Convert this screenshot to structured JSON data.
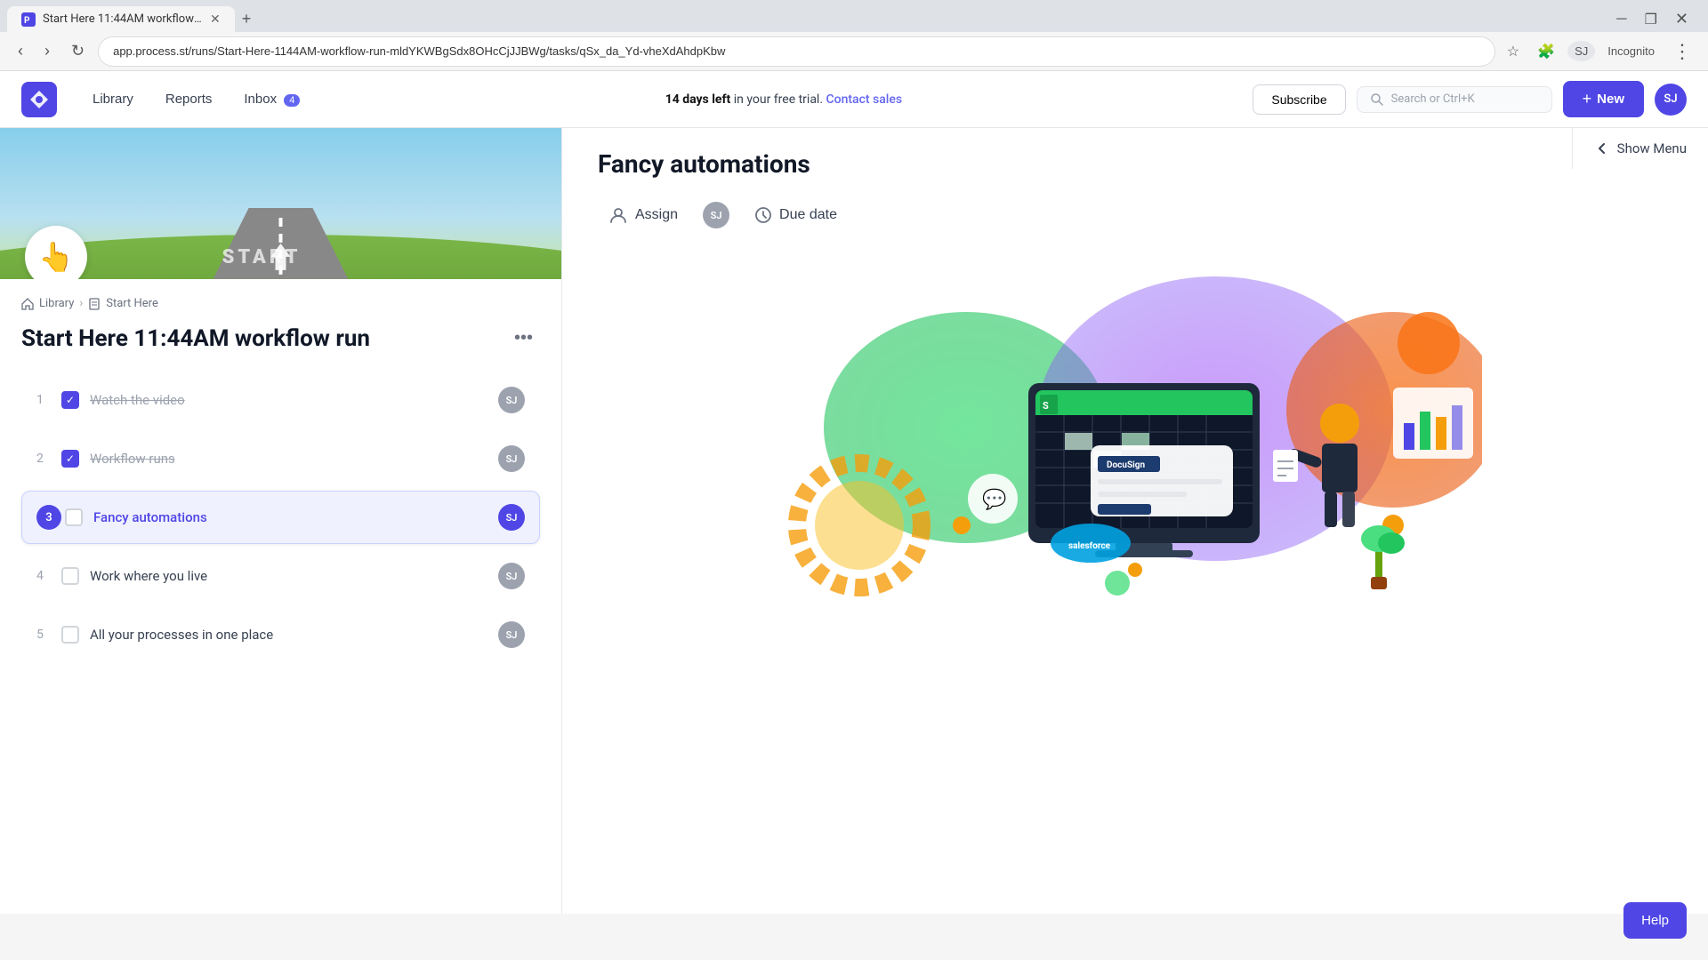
{
  "browser": {
    "tab_title": "Start Here 11:44AM workflow run...",
    "address": "app.process.st/runs/Start-Here-1144AM-workflow-run-mldYKWBgSdx8OHcCjJJBWg/tasks/qSx_da_Yd-vheXdAhdpKbw",
    "new_tab_label": "+"
  },
  "navbar": {
    "logo_alt": "Process Street",
    "library_label": "Library",
    "reports_label": "Reports",
    "inbox_label": "Inbox",
    "inbox_count": "4",
    "trial_text_bold": "14 days left",
    "trial_text": " in your free trial.",
    "contact_sales_label": "Contact sales",
    "subscribe_label": "Subscribe",
    "search_placeholder": "Search or Ctrl+K",
    "new_label": "New",
    "avatar_initials": "SJ"
  },
  "left_panel": {
    "breadcrumb_library": "Library",
    "breadcrumb_start": "Start Here",
    "workflow_title": "Start Here 11:44AM workflow run",
    "more_icon": "•••",
    "tasks": [
      {
        "number": "1",
        "label": "Watch the video",
        "done": true,
        "active": false,
        "avatar": "SJ"
      },
      {
        "number": "2",
        "label": "Workflow runs",
        "done": true,
        "active": false,
        "avatar": "SJ"
      },
      {
        "number": "3",
        "label": "Fancy automations",
        "done": false,
        "active": true,
        "avatar": "SJ"
      },
      {
        "number": "4",
        "label": "Work where you live",
        "done": false,
        "active": false,
        "avatar": "SJ"
      },
      {
        "number": "5",
        "label": "All your processes in one place",
        "done": false,
        "active": false,
        "avatar": "SJ"
      }
    ]
  },
  "right_panel": {
    "show_menu_label": "Show Menu",
    "task_heading": "Fancy automations",
    "assign_label": "Assign",
    "assigned_avatar": "SJ",
    "due_date_label": "Due date"
  },
  "help_btn_label": "Help"
}
